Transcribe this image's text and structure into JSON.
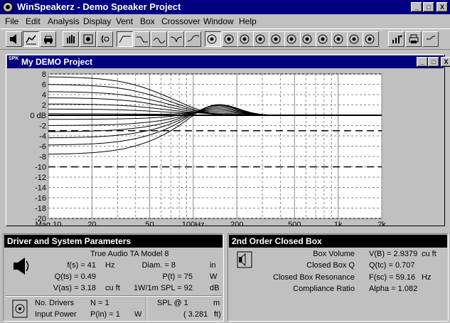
{
  "window": {
    "title": "WinSpeakerz - Demo Speaker Project",
    "min_glyph": "_",
    "max_glyph": "□",
    "close_glyph": "X"
  },
  "menu": [
    "File",
    "Edit",
    "Analysis",
    "Display",
    "Vent",
    "Box",
    "Crossover",
    "Window",
    "Help"
  ],
  "toolbar": {
    "driver_labels": [
      "1",
      "2",
      "3",
      "4",
      "5",
      "6",
      "7",
      "8",
      "9",
      "10"
    ]
  },
  "child_window": {
    "icon_text": "SPK",
    "title": "My DEMO Project"
  },
  "chart_data": {
    "type": "line",
    "x_scale": "log",
    "xlim": [
      10,
      2000
    ],
    "ylim": [
      -20,
      8
    ],
    "x_tick_labels": [
      {
        "x": 10,
        "label": "Mag 10"
      },
      {
        "x": 20,
        "label": "20"
      },
      {
        "x": 50,
        "label": "50"
      },
      {
        "x": 100,
        "label": "100Hz"
      },
      {
        "x": 200,
        "label": "200"
      },
      {
        "x": 500,
        "label": "500"
      },
      {
        "x": 1000,
        "label": "1k"
      },
      {
        "x": 2000,
        "label": "2k"
      }
    ],
    "y_tick_labels": [
      {
        "y": 8,
        "label": "8"
      },
      {
        "y": 6,
        "label": "6"
      },
      {
        "y": 4,
        "label": "4"
      },
      {
        "y": 2,
        "label": "2"
      },
      {
        "y": 0,
        "label": "0 dB"
      },
      {
        "y": -2,
        "label": "-2"
      },
      {
        "y": -4,
        "label": "-4"
      },
      {
        "y": -6,
        "label": "-6"
      },
      {
        "y": -8,
        "label": "-8"
      },
      {
        "y": -10,
        "label": "-10"
      },
      {
        "y": -12,
        "label": "-12"
      },
      {
        "y": -14,
        "label": "-14"
      },
      {
        "y": -16,
        "label": "-16"
      },
      {
        "y": -18,
        "label": "-18"
      },
      {
        "y": -20,
        "label": "-20"
      }
    ],
    "grid": true,
    "reference_lines": [
      -3,
      -10
    ],
    "series": [
      {
        "low_db": 7.5,
        "bump_db": -0.6
      },
      {
        "low_db": 6.0,
        "bump_db": -0.5
      },
      {
        "low_db": 4.6,
        "bump_db": -0.3
      },
      {
        "low_db": 3.4,
        "bump_db": -0.2
      },
      {
        "low_db": 2.2,
        "bump_db": 0.0
      },
      {
        "low_db": 1.2,
        "bump_db": 0.3
      },
      {
        "low_db": 0.3,
        "bump_db": 0.7
      },
      {
        "low_db": -0.8,
        "bump_db": 1.1
      },
      {
        "low_db": -2.0,
        "bump_db": 1.5
      },
      {
        "low_db": -3.2,
        "bump_db": 1.9
      },
      {
        "low_db": -4.4,
        "bump_db": 2.3
      },
      {
        "low_db": -5.8,
        "bump_db": 2.6
      },
      {
        "low_db": -7.6,
        "bump_db": 2.9
      }
    ]
  },
  "driver_panel": {
    "title": "Driver and System Parameters",
    "model": "True Audio TA Model 8",
    "fs": "f(s) = 41",
    "fs_unit": "Hz",
    "qts": "Q(ts) = 0.49",
    "vas": "V(as) = 3.18",
    "vas_unit": "cu ft",
    "diam": "Diam. = 8",
    "diam_unit": "in",
    "pt": "P(t) = 75",
    "pt_unit": "W",
    "spl": "1W/1m SPL = 92",
    "spl_unit": "dB",
    "num_drivers_label": "No. Drivers",
    "num_drivers": "N = 1",
    "input_power_label": "Input Power",
    "input_power": "P(in) = 1",
    "input_power_unit": "W",
    "spl_at": "SPL @ 1",
    "spl_at_unit": "m",
    "spl_at_ft": "( 3.281",
    "spl_at_ft_unit": "ft)"
  },
  "box_panel": {
    "title": "2nd Order Closed Box",
    "rows": [
      {
        "label": "Box Volume",
        "value": "V(B) = 2.9379",
        "unit": "cu ft"
      },
      {
        "label": "Closed Box Q",
        "value": "Q(tc) = 0.707",
        "unit": ""
      },
      {
        "label": "Closed Box Resonance",
        "value": "F(sc) = 59.16",
        "unit": "Hz"
      },
      {
        "label": "Compliance Ratio",
        "value": "Alpha = 1.082",
        "unit": ""
      }
    ]
  }
}
